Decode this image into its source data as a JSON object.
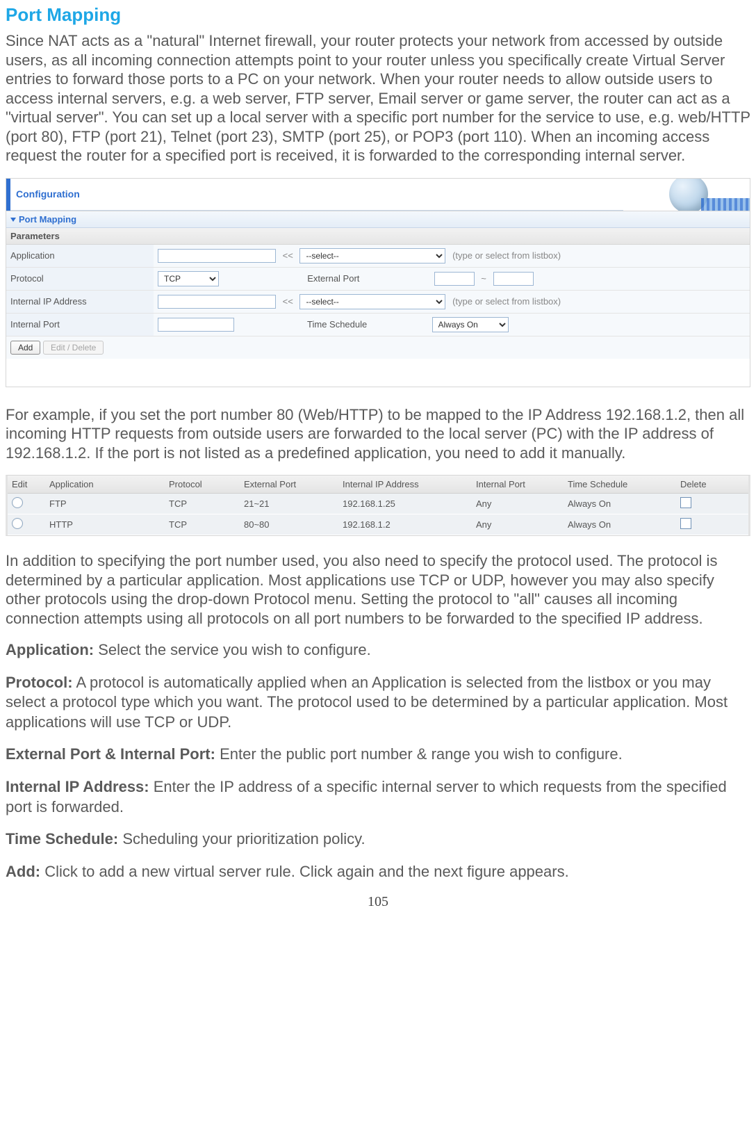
{
  "title": "Port Mapping",
  "intro": "Since NAT acts as a \"natural\" Internet firewall, your router protects your network from accessed by outside users, as all incoming connection attempts point to your router unless you specifically create Virtual Server entries to forward those ports to a PC on your network. When your router needs to allow outside users to access internal servers, e.g. a web server, FTP server, Email server or game server, the router can act as a \"virtual server\". You can set up a local server with a specific port number for the service to use, e.g. web/HTTP (port 80), FTP (port 21), Telnet (port 23), SMTP (port 25), or POP3 (port 110). When an incoming access request the router for a specified port is received, it is forwarded to the corresponding internal server.",
  "config_header": "Configuration",
  "pm_header": "Port Mapping",
  "param_header": "Parameters",
  "form": {
    "application_label": "Application",
    "app_select_placeholder": "--select--",
    "app_hint": "(type or select from listbox)",
    "protocol_label": "Protocol",
    "protocol_value": "TCP",
    "ext_port_label": "External Port",
    "ext_sep": "~",
    "int_ip_label": "Internal IP Address",
    "int_ip_select_placeholder": "--select--",
    "int_ip_hint": "(type or select from listbox)",
    "int_port_label": "Internal Port",
    "time_label": "Time Schedule",
    "time_value": "Always On",
    "btn_add": "Add",
    "btn_edit": "Edit / Delete",
    "ltlt": "<<"
  },
  "mid_para": "For example, if you set the port number 80 (Web/HTTP) to be mapped to the IP Address 192.168.1.2, then all incoming HTTP requests from outside users are forwarded to the local server (PC) with the IP address of 192.168.1.2. If the port is not listed as a predefined application, you need to add it manually.",
  "list": {
    "headers": {
      "edit": "Edit",
      "application": "Application",
      "protocol": "Protocol",
      "ext": "External Port",
      "int_ip": "Internal IP Address",
      "int_port": "Internal Port",
      "time": "Time Schedule",
      "del": "Delete"
    },
    "rows": [
      {
        "application": "FTP",
        "protocol": "TCP",
        "ext": "21~21",
        "int_ip": "192.168.1.25",
        "int_port": "Any",
        "time": "Always On"
      },
      {
        "application": "HTTP",
        "protocol": "TCP",
        "ext": "80~80",
        "int_ip": "192.168.1.2",
        "int_port": "Any",
        "time": "Always On"
      }
    ]
  },
  "post_list_para": "In addition to specifying the port number used, you also need to specify the protocol used. The protocol is determined by a particular application. Most applications use TCP or UDP, however you may also specify other protocols using the drop-down Protocol menu. Setting the protocol to \"all\" causes all incoming connection attempts using all protocols on all port numbers to be forwarded to the specified IP address.",
  "defs": {
    "application": {
      "term": "Application:",
      "text": " Select the service you wish to configure."
    },
    "protocol": {
      "term": "Protocol:",
      "text": " A protocol is automatically applied when an Application is selected from the listbox or you may select a protocol type which you want. The protocol used to be determined by a particular application. Most applications will use TCP or UDP."
    },
    "ports": {
      "term": "External Port & Internal Port:",
      "text": " Enter the public port number & range you wish to configure."
    },
    "int_ip": {
      "term": "Internal IP Address:",
      "text": " Enter the IP address of a specific internal server to which requests from the specified port is forwarded."
    },
    "time": {
      "term": "Time Schedule:",
      "text": " Scheduling your prioritization policy."
    },
    "add": {
      "term": "Add:",
      "text": " Click to add a new virtual server rule. Click again and the next figure appears."
    }
  },
  "page_number": "105"
}
